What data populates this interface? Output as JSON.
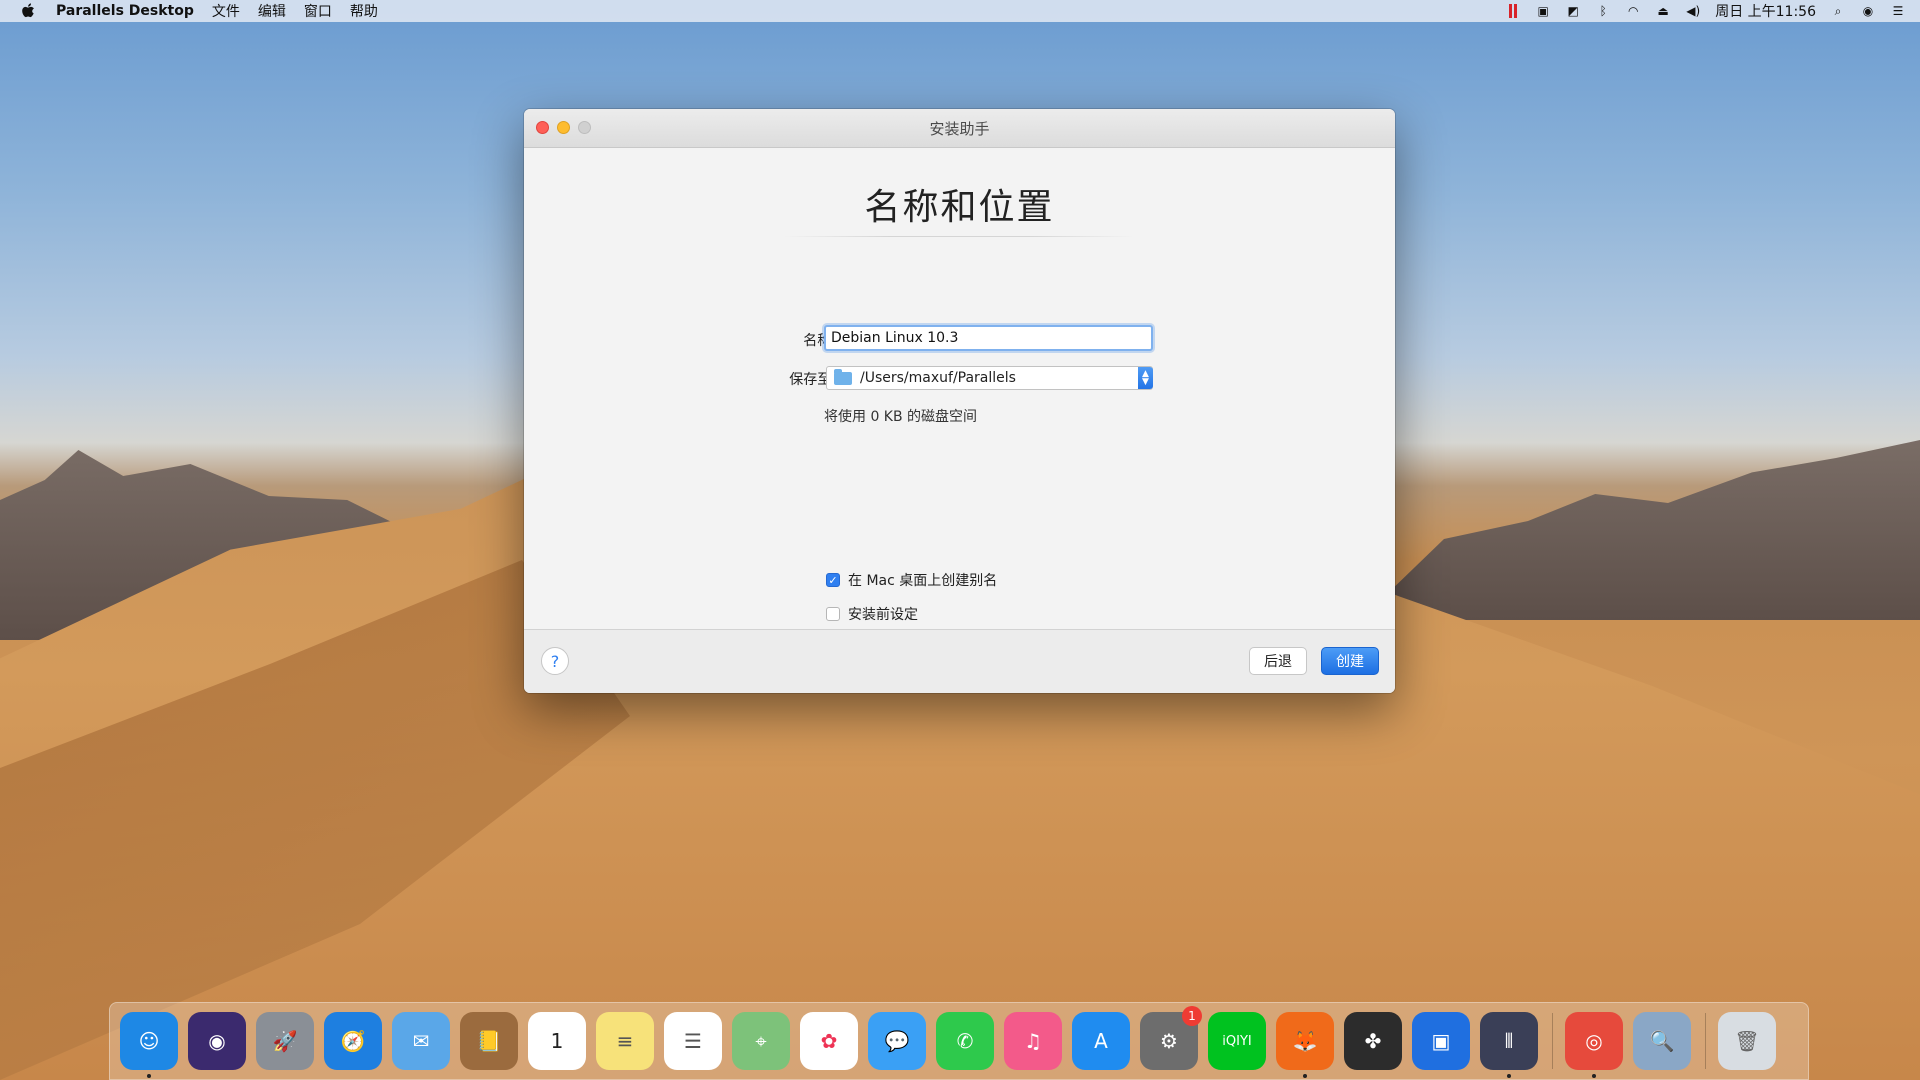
{
  "menubar": {
    "app_name": "Parallels Desktop",
    "items": [
      "文件",
      "编辑",
      "窗口",
      "帮助"
    ],
    "clock": "周日 上午11:56"
  },
  "window": {
    "title": "安装助手",
    "heading": "名称和位置",
    "name_label": "名称:",
    "name_value": "Debian Linux 10.3",
    "save_label": "保存至:",
    "save_path": "/Users/maxuf/Parallels",
    "disk_usage": "将使用 0 KB 的磁盘空间",
    "checkbox_alias": {
      "label": "在 Mac 桌面上创建别名",
      "checked": true
    },
    "checkbox_customize": {
      "label": "安装前设定",
      "checked": false
    },
    "help_label": "?",
    "back_label": "后退",
    "create_label": "创建"
  },
  "dock": {
    "items": [
      {
        "name": "finder-icon",
        "glyph": "☺",
        "color": "#1e88e5",
        "running": true
      },
      {
        "name": "siri-icon",
        "glyph": "◉",
        "color": "#3b2a6e"
      },
      {
        "name": "launchpad-icon",
        "glyph": "🚀",
        "color": "#8a8f96"
      },
      {
        "name": "safari-icon",
        "glyph": "🧭",
        "color": "#1e7fe0"
      },
      {
        "name": "mail-icon",
        "glyph": "✉",
        "color": "#5aa7e8"
      },
      {
        "name": "contacts-icon",
        "glyph": "📒",
        "color": "#9b6b3e"
      },
      {
        "name": "calendar-icon",
        "glyph": "1",
        "color": "#ffffff",
        "text_color": "#222"
      },
      {
        "name": "notes-icon",
        "glyph": "≡",
        "color": "#f7e27a",
        "text_color": "#555"
      },
      {
        "name": "reminders-icon",
        "glyph": "☰",
        "color": "#ffffff",
        "text_color": "#555"
      },
      {
        "name": "maps-icon",
        "glyph": "⌖",
        "color": "#7dc27a"
      },
      {
        "name": "photos-icon",
        "glyph": "✿",
        "color": "#ffffff",
        "text_color": "#e35"
      },
      {
        "name": "messages-icon",
        "glyph": "💬",
        "color": "#3aa0f5"
      },
      {
        "name": "facetime-icon",
        "glyph": "✆",
        "color": "#2ec94c"
      },
      {
        "name": "itunes-icon",
        "glyph": "♫",
        "color": "#f35a8a"
      },
      {
        "name": "app-store-icon",
        "glyph": "A",
        "color": "#1f8cf0"
      },
      {
        "name": "system-preferences-icon",
        "glyph": "⚙",
        "color": "#6d6d6d",
        "badge": "1"
      },
      {
        "name": "iqiyi-icon",
        "glyph": "iQIYI",
        "color": "#00c21f"
      },
      {
        "name": "firefox-icon",
        "glyph": "🦊",
        "color": "#f06a1a",
        "running": true
      },
      {
        "name": "clover-icon",
        "glyph": "✤",
        "color": "#2c2c2c"
      },
      {
        "name": "vmware-icon",
        "glyph": "▣",
        "color": "#1f6fe0"
      },
      {
        "name": "parallels-icon",
        "glyph": "⫴",
        "color": "#3a3f57",
        "running": true
      },
      {
        "name": "chrome-icon",
        "glyph": "◎",
        "color": "#e64a3c",
        "running": true
      },
      {
        "name": "preview-icon",
        "glyph": "🔍",
        "color": "#8aa7c6"
      },
      {
        "name": "trash-icon",
        "glyph": "🗑",
        "color": "#d8dde2",
        "text_color": "#666"
      }
    ]
  }
}
